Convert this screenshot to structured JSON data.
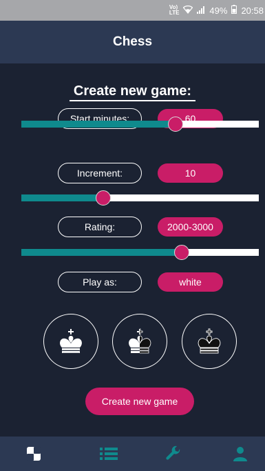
{
  "status_bar": {
    "network": "Vo) LTE",
    "battery": "49%",
    "time": "20:58"
  },
  "app_bar": {
    "title": "Chess"
  },
  "form": {
    "heading": "Create new game:",
    "start_minutes": {
      "label": "Start minutes:",
      "value": "60",
      "slider_fraction": 0.65
    },
    "increment": {
      "label": "Increment:",
      "value": "10",
      "slider_fraction": 0.345
    },
    "rating": {
      "label": "Rating:",
      "value": "2000-3000",
      "slider_fraction": 0.675
    },
    "play_as": {
      "label": "Play as:",
      "value": "white"
    },
    "color_options": [
      "white-king-icon",
      "half-white-half-black-king-icon",
      "black-king-icon"
    ],
    "create_button": "Create new game"
  },
  "bottom_nav": {
    "items": [
      "board-icon",
      "list-icon",
      "wrench-icon",
      "user-icon"
    ],
    "active": "board-icon"
  },
  "colors": {
    "background": "#1b2232",
    "app_bar": "#2c3953",
    "accent_pink": "#c91d67",
    "slider_fill": "#0f8a8d",
    "nav_inactive": "#0f8a8d"
  }
}
